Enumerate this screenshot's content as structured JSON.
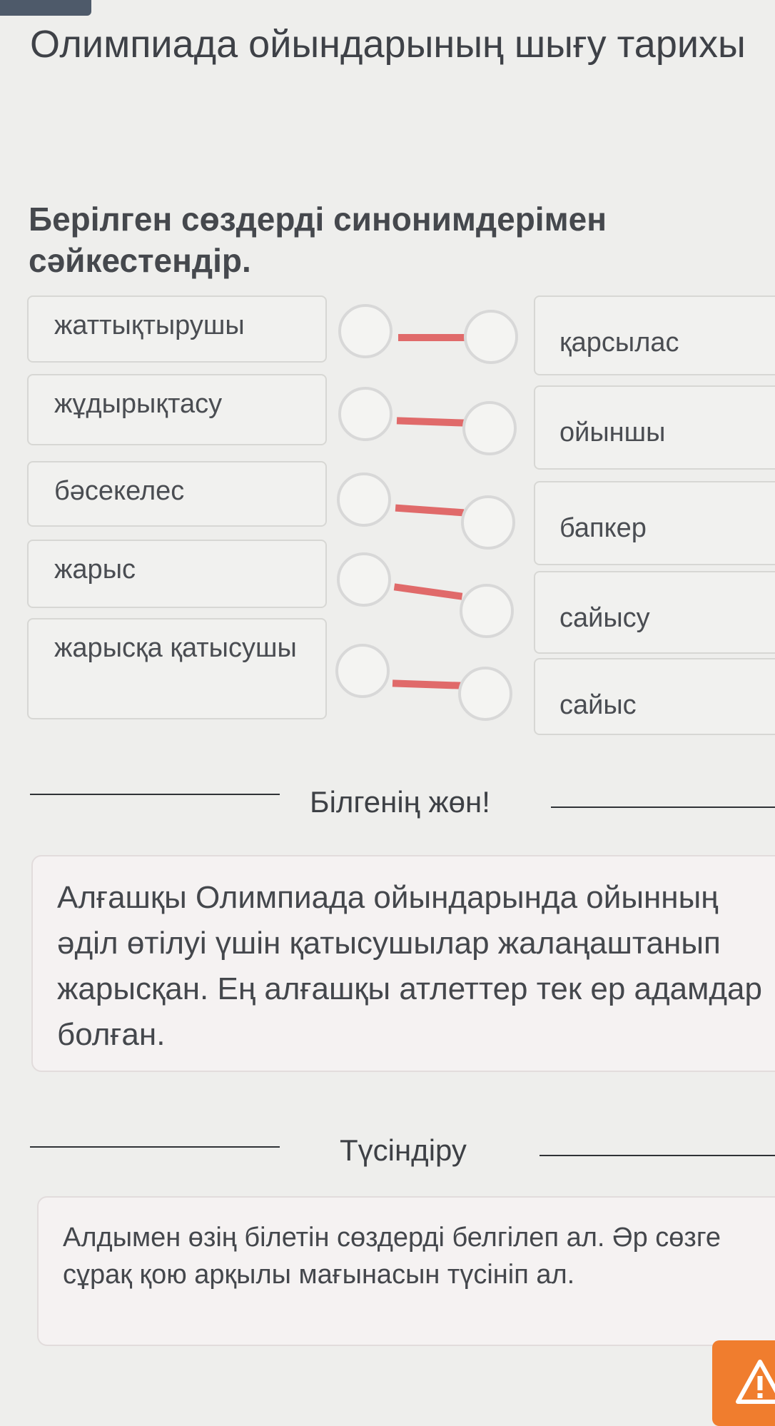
{
  "title": "Олимпиада ойындарының шығу тарихы",
  "task": {
    "prompt": "Берілген сөздерді синонимдерімен сәйкестендір."
  },
  "matching": {
    "left_items": [
      "жаттықтырушы",
      "жұдырықтасу",
      "бәсекелес",
      "жарыс",
      "жарысқа қатысушы"
    ],
    "right_items": [
      "қарсылас",
      "ойыншы",
      "бапкер",
      "сайысу",
      "сайыс"
    ]
  },
  "did_you_know": {
    "heading": "Білгенің жөн!",
    "text": "Алғашқы Олимпиада ойындарында ойынның әділ өтілуі үшін қатысушылар жалаңаштанып жарысқан. Ең алғашқы атлеттер тек ер адамдар болған."
  },
  "explanation": {
    "heading": "Түсіндіру",
    "text": "Алдымен өзің білетін сөздерді белгілеп ал. Әр сөзге сұрақ қою арқылы мағынасын түсініп ал."
  },
  "colors": {
    "connector": "#e06a6a",
    "circle": "#d8d8d8",
    "warning": "#f07d2e"
  },
  "icons": [
    "warning-icon"
  ]
}
